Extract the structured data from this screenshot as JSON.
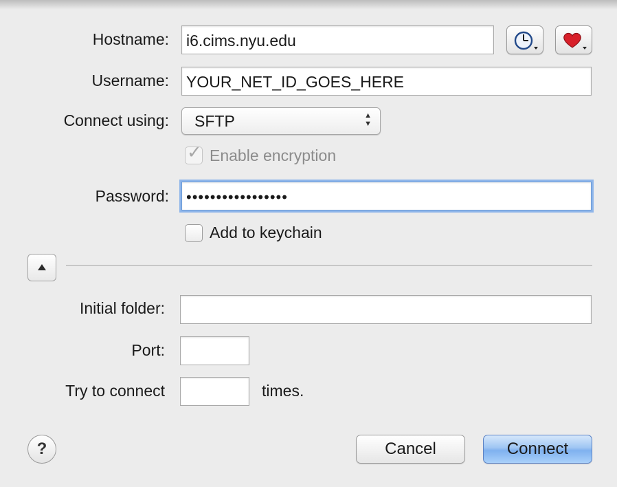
{
  "form": {
    "hostname_label": "Hostname:",
    "hostname_value": "i6.cims.nyu.edu",
    "username_label": "Username:",
    "username_value": "YOUR_NET_ID_GOES_HERE",
    "connect_using_label": "Connect using:",
    "connect_using_value": "SFTP",
    "enable_encryption_label": "Enable encryption",
    "enable_encryption_checked": true,
    "password_label": "Password:",
    "password_masked": "•••••••••••••••••",
    "add_to_keychain_label": "Add to keychain",
    "add_to_keychain_checked": false
  },
  "advanced": {
    "initial_folder_label": "Initial folder:",
    "initial_folder_value": "",
    "port_label": "Port:",
    "port_value": "",
    "try_connect_label": "Try to connect",
    "try_connect_value": "",
    "times_label": "times."
  },
  "footer": {
    "help_label": "?",
    "cancel_label": "Cancel",
    "connect_label": "Connect"
  },
  "icons": {
    "history": "clock-icon",
    "favorites": "heart-icon"
  },
  "colors": {
    "primary_button": "#7fb1ef",
    "focus_ring": "#8fb6ea",
    "heart": "#d8202a"
  }
}
